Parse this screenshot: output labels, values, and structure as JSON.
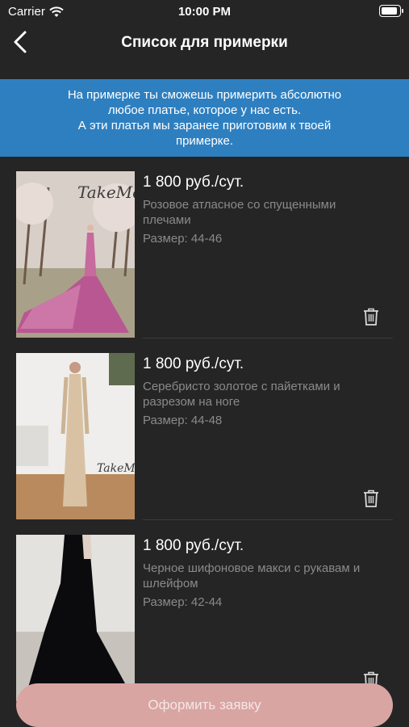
{
  "status_bar": {
    "carrier": "Carrier",
    "time": "10:00 PM"
  },
  "nav": {
    "title": "Список для примерки"
  },
  "banner": {
    "text": "На примерке ты сможешь примерить абсолютно\nлюбое платье, которое у нас есть.\nА эти платья мы заранее приготовим к твоей\nпримерке."
  },
  "items": [
    {
      "price": "1 800 руб./сут.",
      "description": "Розовое атласное со спущенными плечами",
      "size": "Размер: 44-46",
      "brand": "TakeMe"
    },
    {
      "price": "1 800 руб./сут.",
      "description": "Серебристо золотое с пайетками и разрезом на ноге",
      "size": "Размер: 44-48",
      "brand": "TakeMe"
    },
    {
      "price": "1 800 руб./сут.",
      "description": "Черное шифоновое макси с рукавам и шлейфом",
      "size": "Размер: 42-44"
    }
  ],
  "submit": {
    "label": "Оформить заявку"
  },
  "colors": {
    "background": "#252525",
    "banner": "#2e7fc0",
    "button": "#d9a5a3",
    "secondary_text": "#8a8a8a"
  }
}
